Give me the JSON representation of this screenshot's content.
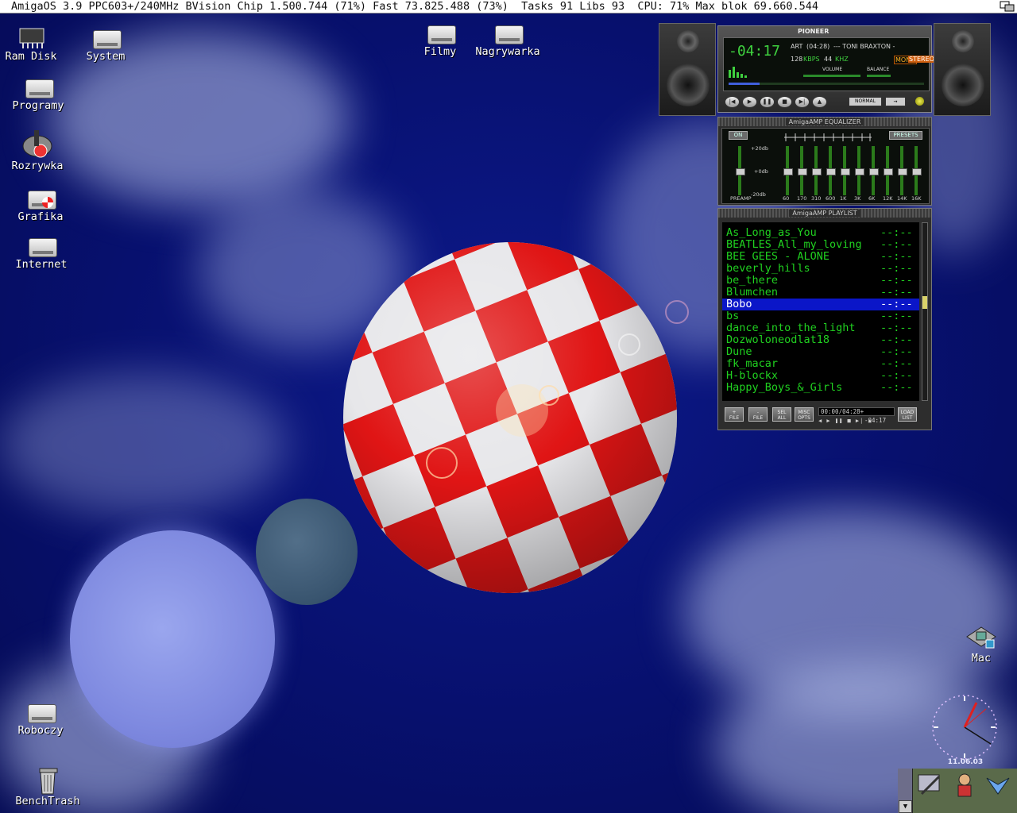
{
  "top_bar": {
    "text": "AmigaOS 3.9 PPC603+/240MHz BVision Chip 1.500.744 (71%) Fast 73.825.488 (73%)  Tasks 91 Libs 93  CPU: 71% Max blok 69.660.544"
  },
  "desktop_icons": {
    "ram_disk": "Ram Disk",
    "system": "System",
    "filmy": "Filmy",
    "nagrywarka": "Nagrywarka",
    "programy": "Programy",
    "rozrywka": "Rozrywka",
    "grafika": "Grafika",
    "internet": "Internet",
    "roboczy": "Roboczy",
    "benchtrash": "BenchTrash",
    "mac": "Mac"
  },
  "player": {
    "brand": "PIONEER",
    "time": "-04:17",
    "art_label": "ART",
    "track_length": "(04:28)",
    "track_title": "--- TONI BRAXTON -",
    "bitrate": "128",
    "kbps": "KBPS",
    "khz_value": "44",
    "khz": "KHZ",
    "mono": "MONO",
    "stereo": "STEREO",
    "volume": "VOLUME",
    "balance": "BALANCE",
    "normal": "NORMAL"
  },
  "equalizer": {
    "title": "AmigaAMP EQUALIZER",
    "on_label": "ON",
    "presets_label": "PRESETS",
    "db_plus": "+20db",
    "db_zero": "+0db",
    "db_minus": "-20db",
    "preamp": "PREAMP",
    "bands": [
      "60",
      "170",
      "310",
      "600",
      "1K",
      "3K",
      "6K",
      "12K",
      "14K",
      "16K"
    ],
    "band_levels": [
      0.5,
      0.5,
      0.5,
      0.5,
      0.5,
      0.5,
      0.5,
      0.5,
      0.5,
      0.5
    ],
    "preamp_level": 0.5
  },
  "playlist": {
    "title": "AmigaAMP PLAYLIST",
    "selected_index": 6,
    "items": [
      {
        "name": "As_Long_as_You",
        "time": "--:--"
      },
      {
        "name": "BEATLES_All_my_loving",
        "time": "--:--"
      },
      {
        "name": "BEE GEES - ALONE",
        "time": "--:--"
      },
      {
        "name": "beverly_hills",
        "time": "--:--"
      },
      {
        "name": "be_there",
        "time": "--:--"
      },
      {
        "name": "Blumchen",
        "time": "--:--"
      },
      {
        "name": "Bobo",
        "time": "--:--"
      },
      {
        "name": "bs",
        "time": "--:--"
      },
      {
        "name": "dance_into_the_light",
        "time": "--:--"
      },
      {
        "name": "Dozwoloneodlat18",
        "time": "--:--"
      },
      {
        "name": "Dune",
        "time": "--:--"
      },
      {
        "name": "fk_macar",
        "time": "--:--"
      },
      {
        "name": "H-blockx",
        "time": "--:--"
      },
      {
        "name": "Happy_Boys_&_Girls",
        "time": "--:--"
      }
    ],
    "buttons": {
      "add": [
        "+",
        "FILE"
      ],
      "rem": [
        "-",
        "FILE"
      ],
      "sel": [
        "SEL",
        "ALL"
      ],
      "misc": [
        "MISC",
        "OPTS"
      ],
      "load": [
        "LOAD",
        "LIST"
      ]
    },
    "time_display": "00:00/04:28+",
    "remaining": "-04:17"
  },
  "clock": {
    "date": "11.06.03"
  },
  "colors": {
    "playlist_text": "#20d020",
    "playlist_selection": "#0b16c8",
    "desktop_bg": "#0a1070"
  }
}
